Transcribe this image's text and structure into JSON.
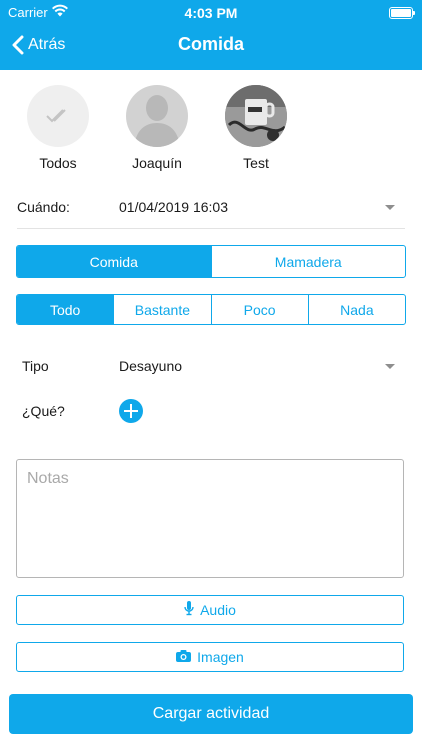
{
  "status_bar": {
    "carrier": "Carrier",
    "time": "4:03 PM"
  },
  "header": {
    "back_label": "Atrás",
    "title": "Comida"
  },
  "people": [
    {
      "name": "Todos"
    },
    {
      "name": "Joaquín"
    },
    {
      "name": "Test"
    }
  ],
  "when": {
    "label": "Cuándo:",
    "value": "01/04/2019 16:03"
  },
  "type_segment": {
    "options": [
      "Comida",
      "Mamadera"
    ],
    "selected": "Comida"
  },
  "amount_segment": {
    "options": [
      "Todo",
      "Bastante",
      "Poco",
      "Nada"
    ],
    "selected": "Todo"
  },
  "tipo": {
    "label": "Tipo",
    "value": "Desayuno"
  },
  "what": {
    "label": "¿Qué?"
  },
  "notes": {
    "placeholder": "Notas",
    "value": ""
  },
  "buttons": {
    "audio": "Audio",
    "image": "Imagen",
    "submit": "Cargar actividad"
  },
  "colors": {
    "accent": "#0fa8ea",
    "border": "#b5b5b5",
    "divider": "#e3e3e3"
  }
}
